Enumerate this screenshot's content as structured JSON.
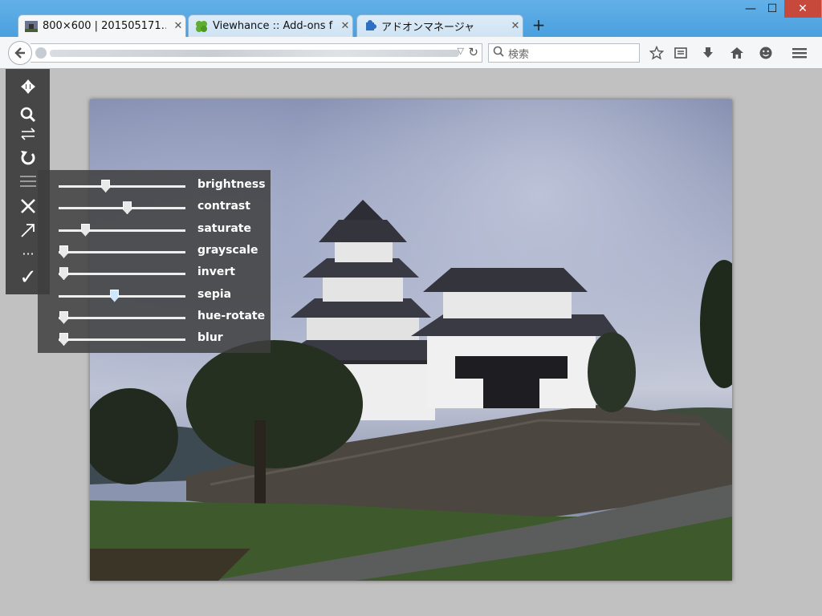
{
  "window": {
    "minimize_label": "—",
    "maximize_label": "☐",
    "close_label": "✕"
  },
  "tabs": [
    {
      "title": "800×600 | 201505171…",
      "favicon": "image-thumbnail-icon"
    },
    {
      "title": "Viewhance :: Add-ons f…",
      "favicon": "puzzle-piece-icon"
    },
    {
      "title": "アドオンマネージャ",
      "favicon": "puzzle-piece-blue-icon"
    }
  ],
  "new_tab_label": "+",
  "search": {
    "placeholder": "検索"
  },
  "toolbar_icons": [
    "bookmark-star-icon",
    "reading-list-icon",
    "download-icon",
    "home-icon",
    "smiley-icon",
    "menu-icon"
  ],
  "sidebar_icons": [
    "move-arrows-icon",
    "zoom-icon",
    "flip-icon",
    "rotate-icon",
    "filter-menu-icon",
    "close-icon",
    "open-external-icon",
    "more-icon",
    "checkmark-icon"
  ],
  "sidebar": {
    "more_label": "···",
    "check_label": "✓"
  },
  "filters": [
    {
      "label": "brightness",
      "value": 0.33
    },
    {
      "label": "contrast",
      "value": 0.5
    },
    {
      "label": "saturate",
      "value": 0.17
    },
    {
      "label": "grayscale",
      "value": 0.0
    },
    {
      "label": "invert",
      "value": 0.0
    },
    {
      "label": "sepia",
      "value": 0.4,
      "highlight": true
    },
    {
      "label": "hue-rotate",
      "value": 0.0
    },
    {
      "label": "blur",
      "value": 0.0
    }
  ],
  "colors": {
    "titlebar": "#4aa0de",
    "close_button": "#c7493c",
    "content_bg": "#c1c1c1",
    "panel_bg": "#3e3e3e"
  }
}
